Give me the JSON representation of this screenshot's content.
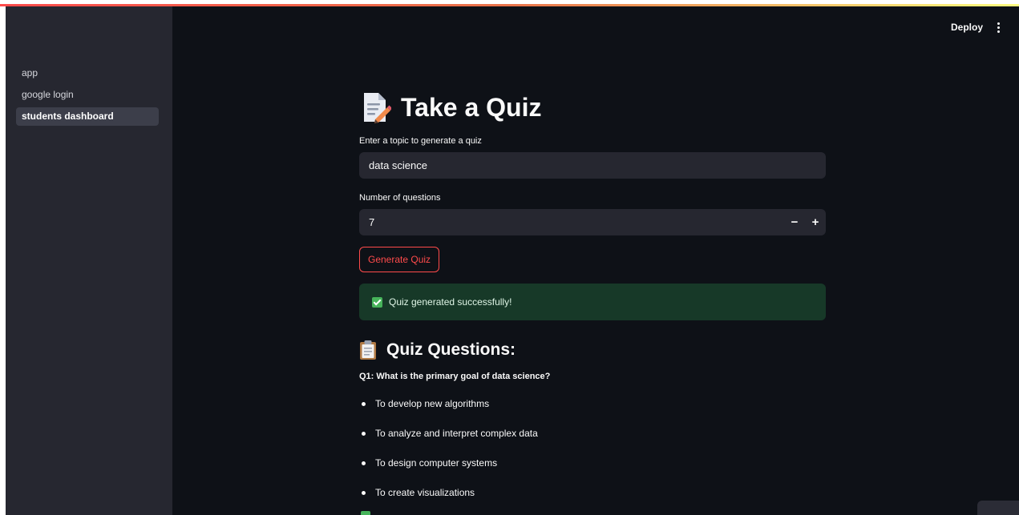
{
  "sidebar": {
    "items": [
      {
        "label": "app"
      },
      {
        "label": "google login"
      },
      {
        "label": "students dashboard"
      }
    ]
  },
  "header": {
    "deploy_label": "Deploy",
    "menu_icon": "vertical-ellipsis-icon"
  },
  "page": {
    "title": "Take a Quiz",
    "title_icon": "memo-icon"
  },
  "topic": {
    "label": "Enter a topic to generate a quiz",
    "value": "data science"
  },
  "questions_count": {
    "label": "Number of questions",
    "value": "7",
    "decrement": "−",
    "increment": "+"
  },
  "generate_button": {
    "label": "Generate Quiz"
  },
  "success": {
    "message": "Quiz generated successfully!"
  },
  "quiz": {
    "heading": "Quiz Questions:",
    "heading_icon": "clipboard-icon",
    "q1": {
      "text": "Q1: What is the primary goal of data science?",
      "options": [
        "To develop new algorithms",
        "To analyze and interpret complex data",
        "To design computer systems",
        "To create visualizations"
      ]
    }
  },
  "colors": {
    "background": "#0e1117",
    "sidebar": "#262730",
    "accent": "#ff4b4b",
    "success_bg": "#173928",
    "success_check": "#46b35a"
  }
}
